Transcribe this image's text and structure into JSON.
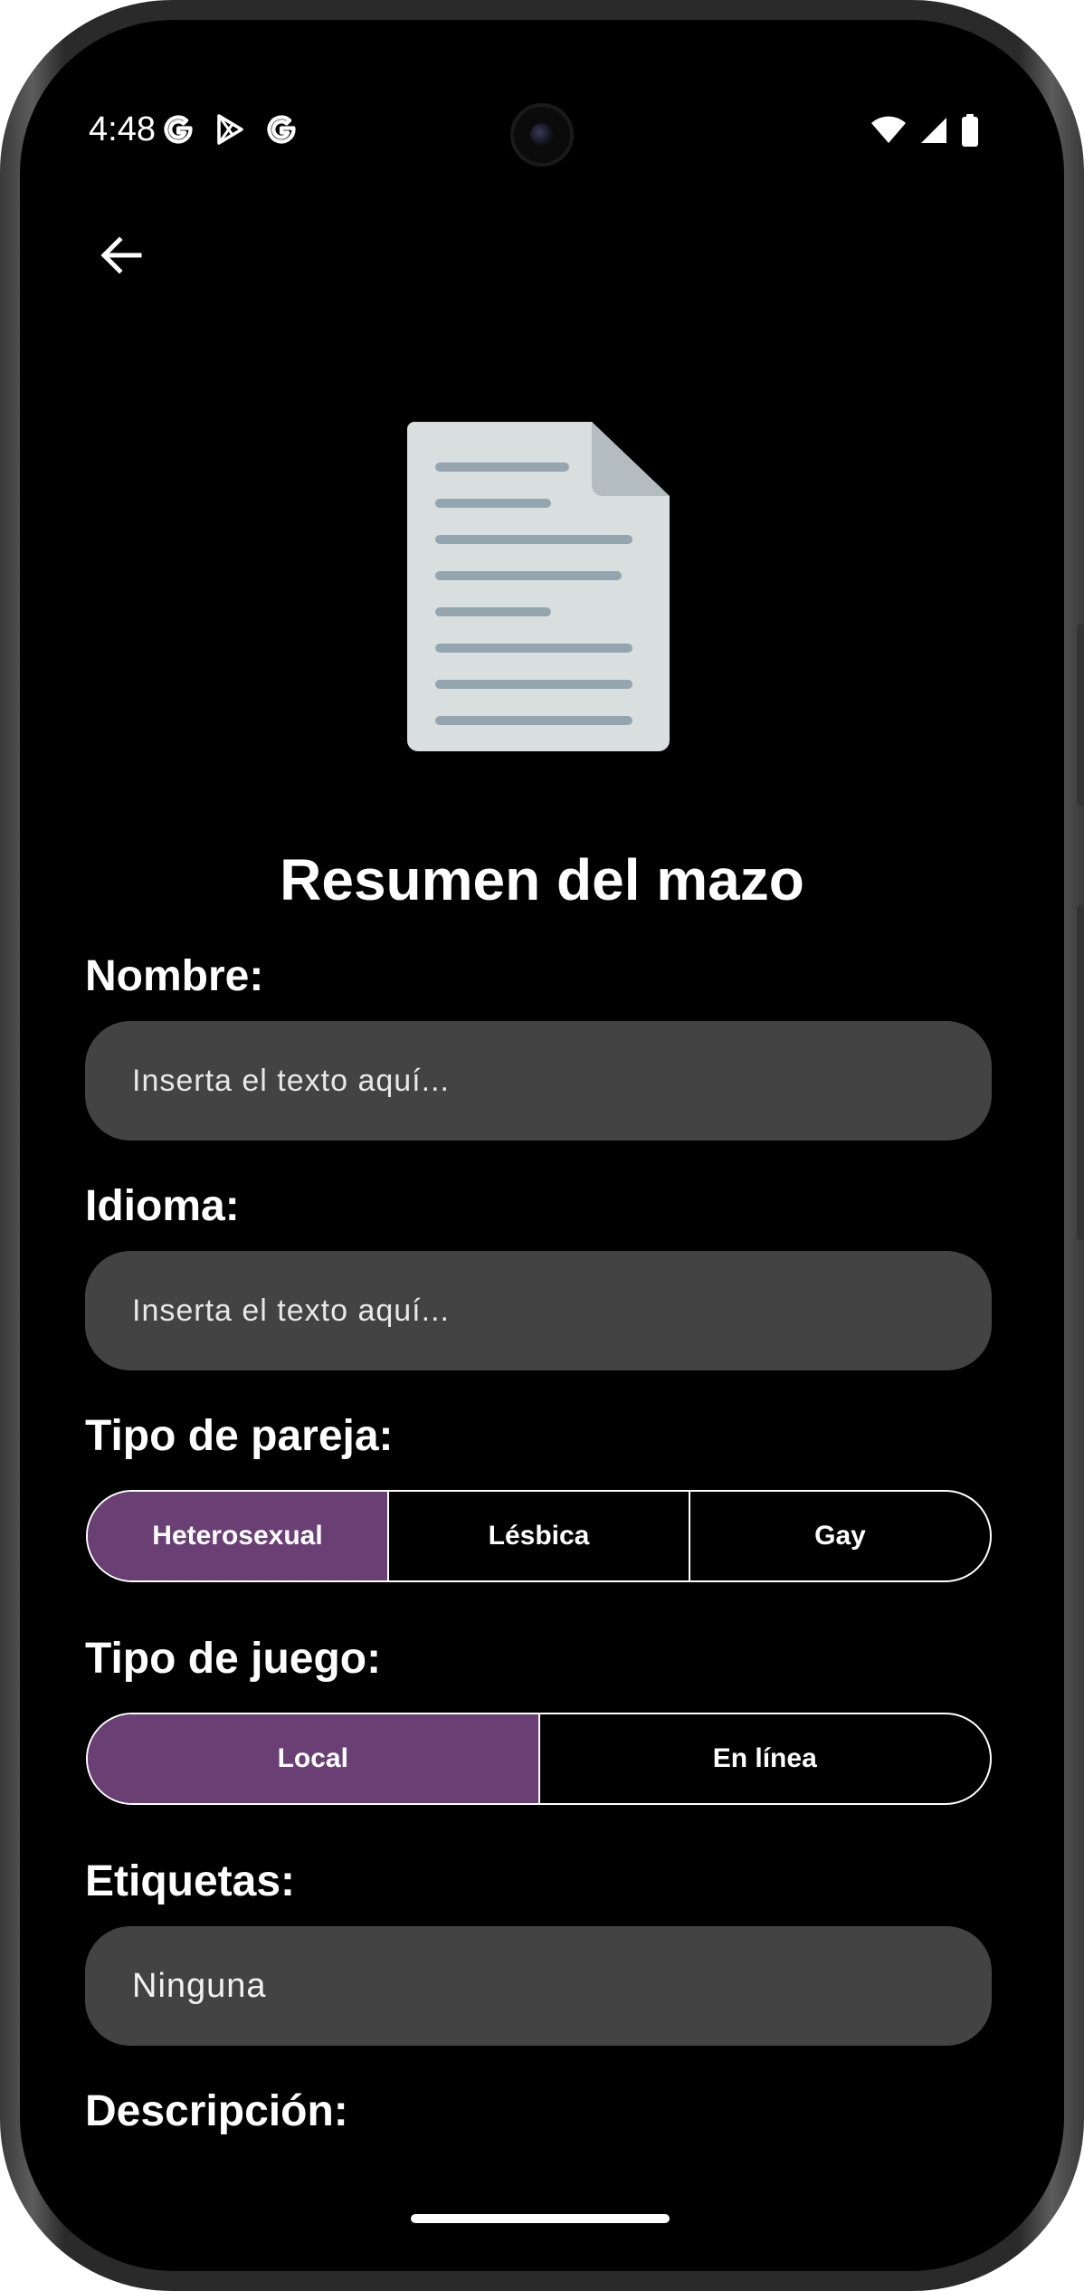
{
  "status_bar": {
    "time": "4:48",
    "left_icons": [
      "google-g-icon",
      "play-store-icon",
      "google-g-icon"
    ],
    "right_icons": [
      "wifi-icon",
      "cell-signal-icon",
      "battery-icon"
    ]
  },
  "header": {
    "back_icon": "arrow-left-icon"
  },
  "hero": {
    "icon": "document-icon",
    "title": "Resumen del mazo"
  },
  "form": {
    "nombre": {
      "label": "Nombre:",
      "placeholder": "Inserta el texto aquí..."
    },
    "idioma": {
      "label": "Idioma:",
      "placeholder": "Inserta el texto aquí..."
    },
    "tipo_pareja": {
      "label": "Tipo de pareja:",
      "options": [
        "Heterosexual",
        "Lésbica",
        "Gay"
      ],
      "selected": "Heterosexual"
    },
    "tipo_juego": {
      "label": "Tipo de juego:",
      "options": [
        "Local",
        "En línea"
      ],
      "selected": "Local"
    },
    "etiquetas": {
      "label": "Etiquetas:",
      "value": "Ninguna"
    },
    "descripcion": {
      "label": "Descripción:"
    }
  },
  "colors": {
    "background": "#000000",
    "field_background": "#434343",
    "selected_segment": "#6a4074",
    "text": "#ffffff"
  }
}
